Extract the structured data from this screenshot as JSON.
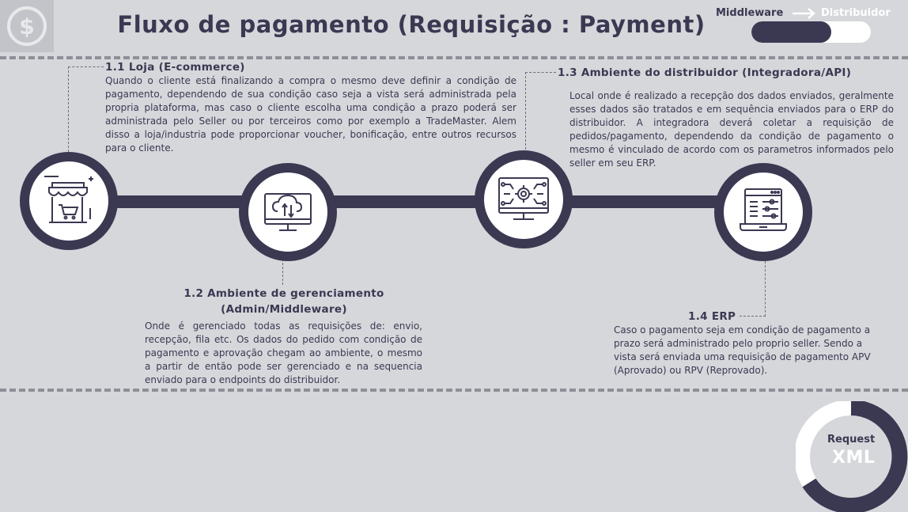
{
  "header": {
    "title": "Fluxo de pagamento (Requisição : Payment)",
    "flow_from": "Middleware",
    "flow_to": "Distribuidor",
    "progress_fraction": 0.67
  },
  "steps": [
    {
      "heading": "1.1 Loja (E-commerce)",
      "text": "Quando o cliente está finalizando a compra o mesmo deve definir a condição de pagamento, dependendo de sua condição caso seja a vista será administrada pela propria plataforma, mas caso o cliente escolha uma condição a prazo poderá ser administrada pelo Seller ou por terceiros como por exemplo a TradeMaster. Alem disso a loja/industria pode proporcionar voucher, bonificação, entre outros recursos para o cliente.",
      "icon": "store-icon"
    },
    {
      "heading_line1": "1.2 Ambiente de gerenciamento",
      "heading_line2": "(Admin/Middleware)",
      "text": "Onde é gerenciado todas as requisições de: envio, recepção, fila etc. Os dados do pedido com condição de pagamento e aprovação chegam ao ambiente, o mesmo a partir de então pode ser gerenciado e na sequencia enviado para o endpoints do distribuidor.",
      "icon": "cloud-monitor-icon"
    },
    {
      "heading": "1.3 Ambiente do distribuidor (Integradora/API)",
      "text": "Local onde é realizado a recepção dos dados enviados, geralmente esses dados são tratados e em sequência enviados para o ERP do distribuidor. A integradora deverá coletar a requisição de pedidos/pagamento, dependendo da condição de pagamento o mesmo é vinculado de acordo com os parametros informados pelo seller em seu ERP.",
      "icon": "monitor-gear-icon"
    },
    {
      "heading": "1.4 ERP",
      "text": "Caso o pagamento seja em condição de pagamento a prazo será administrado pelo proprio seller. Sendo a vista será enviada uma requisição de pagamento APV (Aprovado) ou RPV (Reprovado).",
      "icon": "laptop-settings-icon"
    }
  ],
  "badge": {
    "line1": "Request",
    "line2": "XML"
  },
  "colors": {
    "background": "#d6d7db",
    "primary": "#3b3852",
    "dashed": "#8f8f97",
    "white": "#ffffff"
  }
}
